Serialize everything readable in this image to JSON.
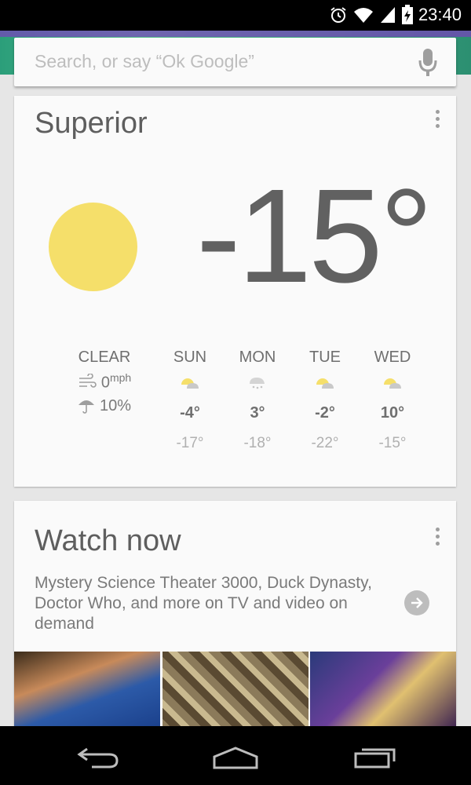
{
  "status_bar": {
    "time": "23:40",
    "icons": [
      "alarm-icon",
      "wifi-icon",
      "signal-icon",
      "battery-charging-icon"
    ]
  },
  "search": {
    "placeholder": "Search, or say “Ok Google”",
    "mic_icon": "mic-icon"
  },
  "weather": {
    "location": "Superior",
    "temperature": "-15°",
    "condition_icon": "sun-icon",
    "condition": "CLEAR",
    "wind": "0",
    "wind_unit": "mph",
    "precip": "10%",
    "forecast": [
      {
        "day": "SUN",
        "icon": "partly-cloudy-icon",
        "high": "-4°",
        "low": "-17°"
      },
      {
        "day": "MON",
        "icon": "snow-icon",
        "high": "3°",
        "low": "-18°"
      },
      {
        "day": "TUE",
        "icon": "partly-cloudy-icon",
        "high": "-2°",
        "low": "-22°"
      },
      {
        "day": "WED",
        "icon": "partly-cloudy-icon",
        "high": "10°",
        "low": "-15°"
      }
    ]
  },
  "watch_now": {
    "title": "Watch now",
    "description": "Mystery Science Theater 3000, Duck Dynasty, Doctor Who, and more on TV and video on demand"
  },
  "colors": {
    "sun": "#f5df6a",
    "card": "#fafafa",
    "background": "#e6e6e6",
    "text": "#616161"
  },
  "nav": {
    "icons": [
      "back-icon",
      "home-icon",
      "recents-icon"
    ]
  }
}
